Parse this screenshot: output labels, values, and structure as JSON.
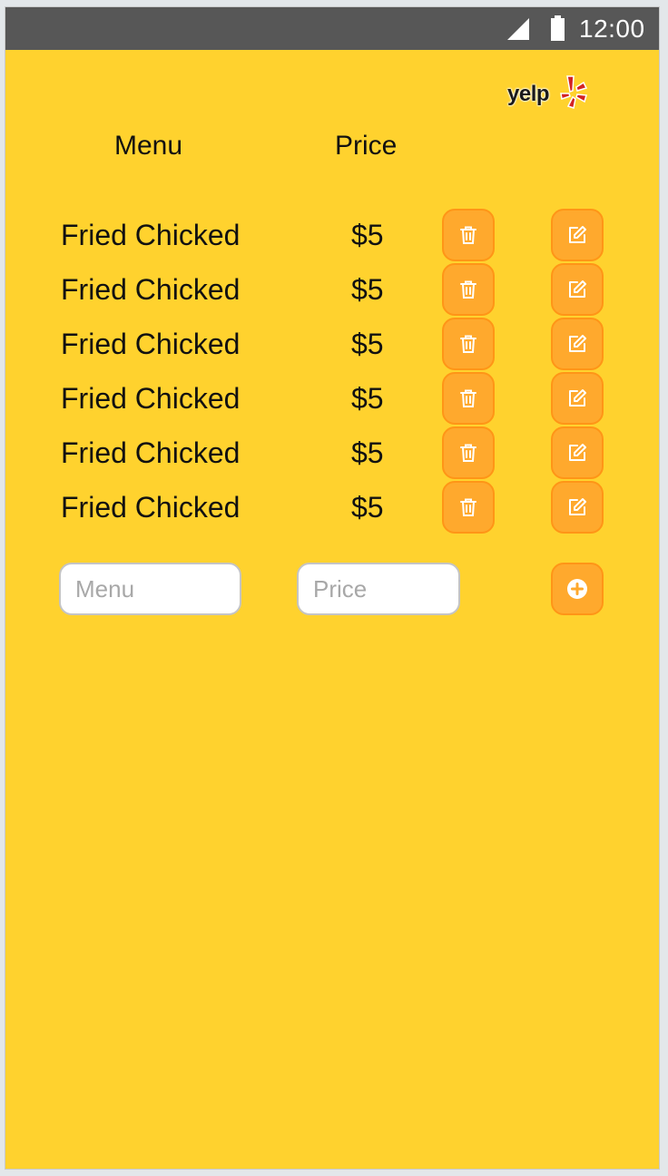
{
  "status_bar": {
    "time": "12:00",
    "icons": [
      "signal-icon",
      "battery-icon"
    ]
  },
  "logo": {
    "text": "yelp",
    "icon": "yelp-burst-icon"
  },
  "table": {
    "headers": {
      "menu": "Menu",
      "price": "Price"
    },
    "rows": [
      {
        "name": "Fried Chicked",
        "price": "$5"
      },
      {
        "name": "Fried Chicked",
        "price": "$5"
      },
      {
        "name": "Fried Chicked",
        "price": "$5"
      },
      {
        "name": "Fried Chicked",
        "price": "$5"
      },
      {
        "name": "Fried Chicked",
        "price": "$5"
      },
      {
        "name": "Fried Chicked",
        "price": "$5"
      }
    ],
    "row_actions": [
      "trash-icon",
      "edit-icon"
    ]
  },
  "add_form": {
    "menu_placeholder": "Menu",
    "menu_value": "",
    "price_placeholder": "Price",
    "price_value": "",
    "add_icon": "plus-circle-icon"
  },
  "colors": {
    "background": "#ffd22e",
    "status_bar": "#575757",
    "button_fill": "#ffa92d",
    "button_border": "#ff9517",
    "logo_accent": "#d32323"
  }
}
